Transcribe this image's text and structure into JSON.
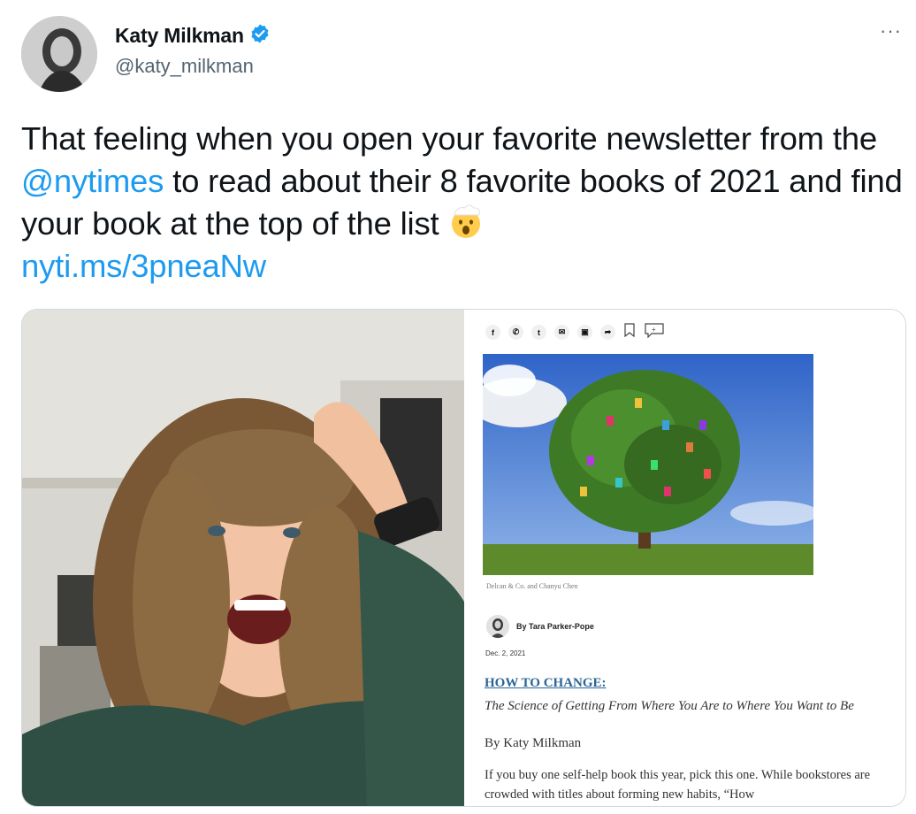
{
  "tweet": {
    "author_name": "Katy Milkman",
    "handle": "@katy_milkman",
    "text_before": "That feeling when you open your favorite newsletter from the ",
    "mention": "@nytimes",
    "text_after": " to read about their 8 favorite books of 2021 and find your book at the top of the list ",
    "link": "nyti.ms/3pneaNw",
    "more_icon": "···",
    "emoji": "exploding-head-emoji",
    "verified_icon": "verified-badge-icon"
  },
  "article": {
    "share_icons": [
      "f",
      "✆",
      "t",
      "✉",
      "▣",
      "➦"
    ],
    "caption": "Delcan & Co. and Chanyu Chen",
    "byline": "By Tara Parker-Pope",
    "date": "Dec. 2, 2021",
    "book_title": "HOW TO CHANGE:",
    "subtitle": "The Science of Getting From Where You Are to Where You Want to Be",
    "author": "By Katy Milkman",
    "body": "If you buy one self-help book this year, pick this one. While bookstores are crowded with titles about forming new habits, “How"
  },
  "colors": {
    "accent": "#1d9bf0",
    "text": "#0f1419",
    "muted": "#536471",
    "nyt_link": "#2a6496"
  }
}
